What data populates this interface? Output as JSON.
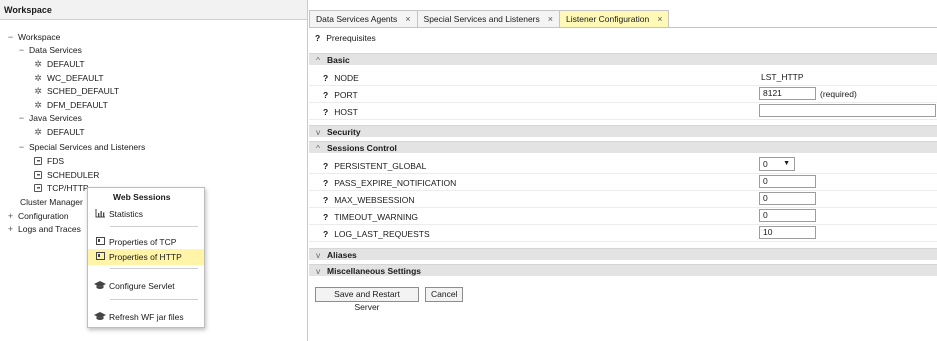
{
  "workspace": {
    "title": "Workspace",
    "tree": [
      {
        "toggle": "−",
        "label": "Workspace"
      },
      {
        "toggle": "−",
        "label": "Data Services"
      },
      {
        "icon": "gear-icon",
        "label": "DEFAULT"
      },
      {
        "icon": "gear-icon",
        "label": "WC_DEFAULT"
      },
      {
        "icon": "gear-icon",
        "label": "SCHED_DEFAULT"
      },
      {
        "icon": "gear-icon",
        "label": "DFM_DEFAULT"
      },
      {
        "toggle": "−",
        "label": "Java Services"
      },
      {
        "icon": "gear-icon",
        "label": "DEFAULT"
      },
      {
        "toggle": "−",
        "label": "Special Services and Listeners"
      },
      {
        "icon": "listener-icon",
        "label": "FDS"
      },
      {
        "icon": "listener-icon",
        "label": "SCHEDULER"
      },
      {
        "icon": "listener-icon",
        "label": "TCP/HTTP"
      },
      {
        "label": "Cluster Manager"
      },
      {
        "toggle": "+",
        "label": "Configuration"
      },
      {
        "toggle": "+",
        "label": "Logs and Traces"
      }
    ]
  },
  "context_menu": {
    "header": "Web Sessions",
    "items": [
      {
        "icon": "chart-icon",
        "label": "Statistics"
      },
      {
        "icon": "properties-icon",
        "label": "Properties of TCP"
      },
      {
        "icon": "properties-icon",
        "label": "Properties of HTTP",
        "selected": true
      },
      {
        "icon": "graduation-cap-icon",
        "label": "Configure Servlet"
      },
      {
        "icon": "graduation-cap-icon",
        "label": "Refresh WF jar files"
      }
    ]
  },
  "tabs": [
    {
      "label": "Data Services Agents",
      "close": "×"
    },
    {
      "label": "Special Services and Listeners",
      "close": "×"
    },
    {
      "label": "Listener Configuration",
      "close": "×",
      "active": true
    }
  ],
  "config": {
    "prerequisites": "Prerequisites",
    "help_mark": "?",
    "sections": {
      "basic": "Basic",
      "security": "Security",
      "sessions": "Sessions Control",
      "aliases": "Aliases",
      "misc": "Miscellaneous Settings"
    },
    "basic": {
      "node_label": "NODE",
      "node_value": "LST_HTTP",
      "port_label": "PORT",
      "port_value": "8121",
      "port_required": "(required)",
      "host_label": "HOST",
      "host_value": ""
    },
    "sessions": {
      "persistent_label": "PERSISTENT_GLOBAL",
      "persistent_value": "0",
      "pass_expire_label": "PASS_EXPIRE_NOTIFICATION",
      "pass_expire_value": "0",
      "max_web_label": "MAX_WEBSESSION",
      "max_web_value": "0",
      "timeout_label": "TIMEOUT_WARNING",
      "timeout_value": "0",
      "log_last_label": "LOG_LAST_REQUESTS",
      "log_last_value": "10"
    },
    "buttons": {
      "save": "Save and Restart Server",
      "cancel": "Cancel"
    }
  },
  "colors": {
    "active_tab": "#fff9b8",
    "menu_selected": "#fff4a8",
    "section_bg": "#e3e3e3"
  }
}
